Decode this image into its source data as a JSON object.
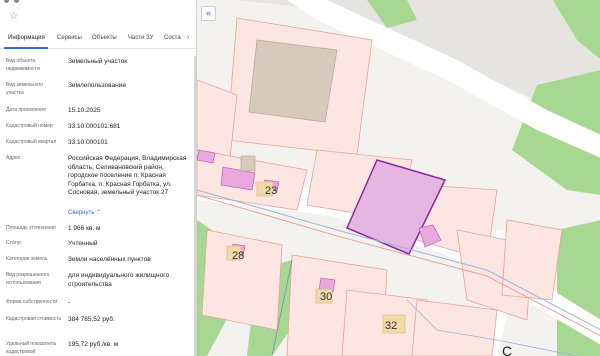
{
  "panel": {
    "top_fragment": "",
    "tabs": [
      {
        "label": "Информация",
        "active": true
      },
      {
        "label": "Сервисы",
        "active": false
      },
      {
        "label": "Объекты",
        "active": false
      },
      {
        "label": "Части ЗУ",
        "active": false
      },
      {
        "label": "Соста",
        "active": false
      }
    ],
    "tab_more": "›",
    "fields": [
      {
        "label": "Вид объекта недвижимости",
        "value": "Земельный участок"
      },
      {
        "label": "Вид земельного участка",
        "value": "Землепользование"
      },
      {
        "label": "Дата присвоения",
        "value": "15.10.2025"
      },
      {
        "label": "Кадастровый номер",
        "value": "33:10:000101:681"
      },
      {
        "label": "Кадастровый квартал",
        "value": "33:10:000101"
      },
      {
        "label": "Адрес",
        "value": "Российская Федерация, Владимирская область, Селивановский район, городское поселение п. Красная Горбатка, п. Красная Горбатка, ул. Сосновая, земельный участок 27"
      },
      {
        "label": "Площадь уточненная",
        "value": "1 966 кв. м"
      },
      {
        "label": "Статус",
        "value": "Учтенный"
      },
      {
        "label": "Категория земель",
        "value": "Земли населённых пунктов"
      },
      {
        "label": "Вид разрешенного использования",
        "value": "для индивидуального жилищного строительства"
      },
      {
        "label": "Форма собственности",
        "value": "-"
      },
      {
        "label": "Кадастровая стоимость",
        "value": "384 785,52 руб."
      },
      {
        "label": "Удельный показатель кадастровой",
        "value": "195,72 руб./кв. м"
      }
    ],
    "collapse_label": "Свернуть",
    "collapse_icon": "chevron-up-icon"
  },
  "map": {
    "collapse_button": "«",
    "house_numbers": [
      "23",
      "28",
      "30",
      "32"
    ],
    "corner_letter": "С",
    "colors": {
      "selected_parcel_fill": "#e6b6e2",
      "selected_parcel_stroke": "#8c2a9e",
      "parcel_fill": "#fbe6e2",
      "parcel_stroke": "#e8a39a",
      "building_fill": "#e9a7dd",
      "forest_green": "#a6d892",
      "road": "#ffffff",
      "river_line": "#9cb3d8"
    }
  }
}
